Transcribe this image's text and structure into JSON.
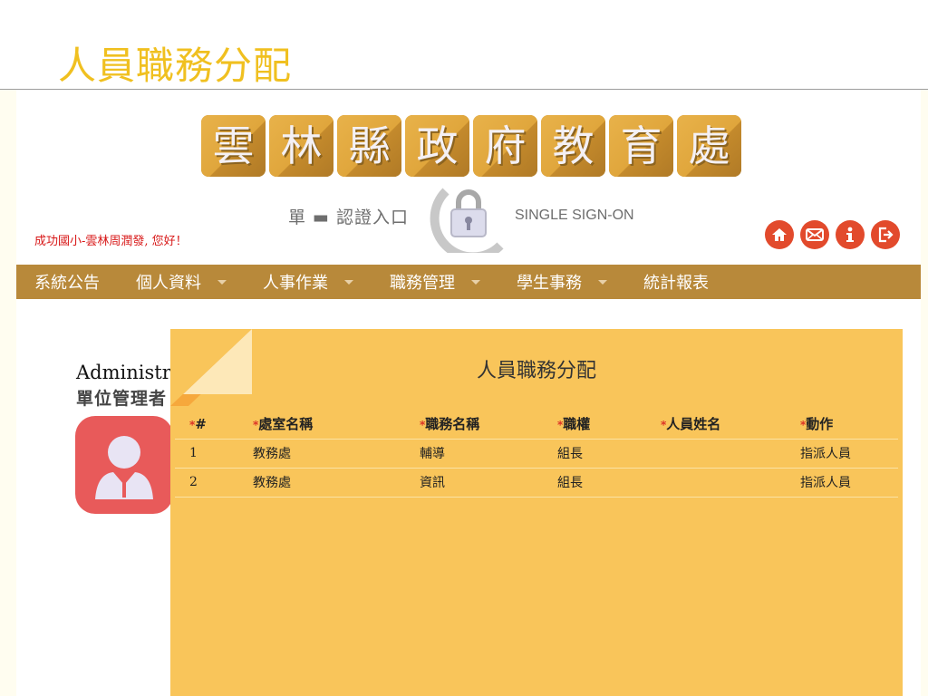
{
  "slide": {
    "title": "人員職務分配"
  },
  "header": {
    "banner_chars": [
      "雲",
      "林",
      "縣",
      "政",
      "府",
      "教",
      "育",
      "處"
    ],
    "sso_left": "單 ▬ 認證入口",
    "sso_right": "SINGLE SIGN-ON",
    "greeting": "成功國小-雲林周潤發, 您好！"
  },
  "top_icons": [
    {
      "name": "home-icon"
    },
    {
      "name": "mail-icon"
    },
    {
      "name": "info-icon"
    },
    {
      "name": "logout-icon"
    }
  ],
  "nav": [
    {
      "label": "系統公告",
      "dropdown": false
    },
    {
      "label": "個人資料",
      "dropdown": true
    },
    {
      "label": "人事作業",
      "dropdown": true
    },
    {
      "label": "職務管理",
      "dropdown": true
    },
    {
      "label": "學生事務",
      "dropdown": true
    },
    {
      "label": "統計報表",
      "dropdown": false
    }
  ],
  "user": {
    "name": "Administrator",
    "role": "單位管理者"
  },
  "panel": {
    "title": "人員職務分配",
    "required_mark": "*",
    "columns": [
      "#",
      "處室名稱",
      "職務名稱",
      "職權",
      "人員姓名",
      "動作"
    ],
    "rows": [
      {
        "no": "1",
        "office": "教務處",
        "position": "輔導",
        "role": "組長",
        "person": "",
        "action": "指派人員"
      },
      {
        "no": "2",
        "office": "教務處",
        "position": "資訊",
        "role": "組長",
        "person": "",
        "action": "指派人員"
      }
    ]
  },
  "colors": {
    "title": "#f0c020",
    "nav_bg": "#b8893a",
    "panel_bg": "#f9c55a",
    "icon_bg": "#e24a2c",
    "avatar_bg": "#e85a5a"
  }
}
